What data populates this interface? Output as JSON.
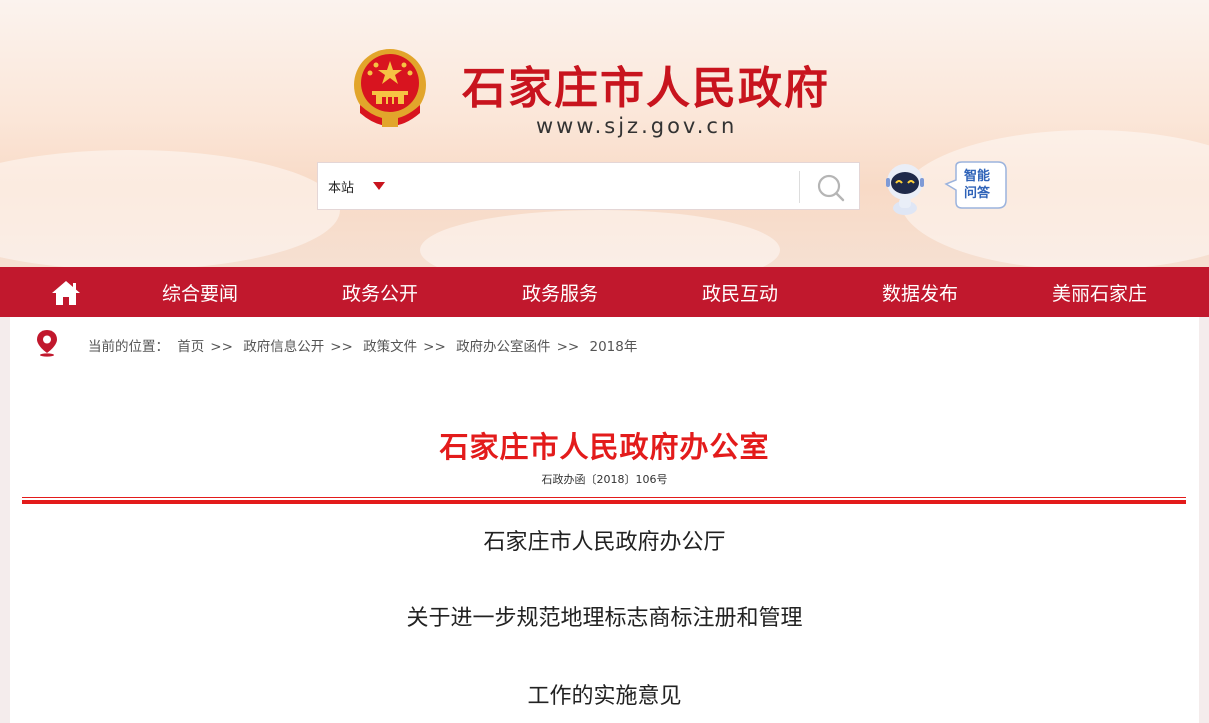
{
  "header": {
    "title": "石家庄市人民政府",
    "url": "www.sjz.gov.cn",
    "brand_color": "#c8141e"
  },
  "search": {
    "scope": "本站",
    "placeholder": "",
    "icon": "search-icon"
  },
  "assistant": {
    "label_line1": "智能",
    "label_line2": "问答",
    "icon": "robot-icon"
  },
  "nav": {
    "background": "#c1182d",
    "home_icon": "home-icon",
    "items": [
      "综合要闻",
      "政务公开",
      "政务服务",
      "政民互动",
      "数据发布",
      "美丽石家庄"
    ]
  },
  "breadcrumb": {
    "prefix": "当前的位置：",
    "items": [
      "首页",
      "政府信息公开",
      "政策文件",
      "政府办公室函件",
      "2018年"
    ],
    "separator": ">>",
    "icon": "location-pin-icon"
  },
  "document": {
    "office": "石家庄市人民政府办公室",
    "number": "石政办函〔2018〕106号",
    "lines": [
      "石家庄市人民政府办公厅",
      "关于进一步规范地理标志商标注册和管理",
      "工作的实施意见"
    ],
    "accent_color": "#e31b1b"
  }
}
